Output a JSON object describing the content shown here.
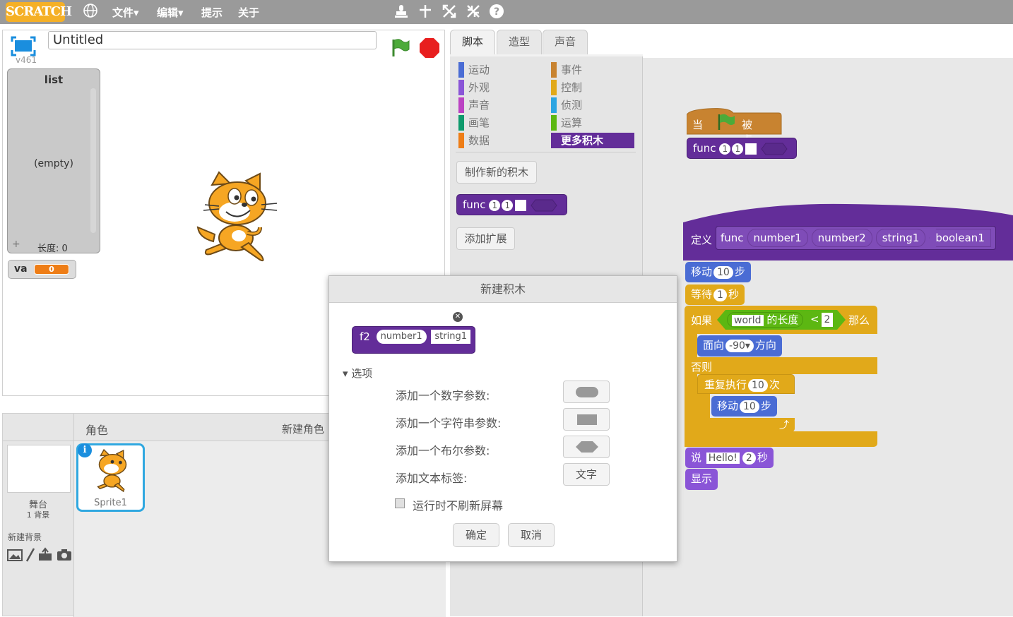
{
  "menubar": {
    "logo": "SCRATCH",
    "file": "文件▾",
    "edit": "编辑▾",
    "tips": "提示",
    "about": "关于"
  },
  "stage": {
    "title": "Untitled",
    "version": "v461",
    "list": {
      "title": "list",
      "empty": "(empty)",
      "plus": "+",
      "length": "长度: 0"
    },
    "variable": {
      "name": "va",
      "value": "0"
    }
  },
  "tabs": [
    "脚本",
    "造型",
    "声音"
  ],
  "palette": {
    "categories_left": [
      {
        "label": "运动",
        "color": "#4a6cd4"
      },
      {
        "label": "外观",
        "color": "#8a55d7"
      },
      {
        "label": "声音",
        "color": "#bb42c3"
      },
      {
        "label": "画笔",
        "color": "#0e9a6c"
      },
      {
        "label": "数据",
        "color": "#ee7d16"
      }
    ],
    "categories_right": [
      {
        "label": "事件",
        "color": "#c88330"
      },
      {
        "label": "控制",
        "color": "#e1a91a"
      },
      {
        "label": "侦测",
        "color": "#2ca5e2"
      },
      {
        "label": "运算",
        "color": "#5cb712"
      },
      {
        "label": "更多积木",
        "color": "#632d99"
      }
    ],
    "make_block": "制作新的积木",
    "add_extension": "添加扩展",
    "func_block": {
      "name": "func",
      "n1": "1",
      "n2": "1"
    }
  },
  "script": {
    "hat": {
      "when": "当",
      "clicked": "被点击"
    },
    "func_call": {
      "name": "func",
      "n1": "1",
      "n2": "1"
    },
    "define": {
      "label": "定义",
      "name": "func",
      "args": [
        "number1",
        "number2",
        "string1",
        "boolean1"
      ]
    },
    "move1": {
      "label": "移动",
      "steps": "10",
      "unit": "步"
    },
    "wait": {
      "label": "等待",
      "secs": "1",
      "unit": "秒"
    },
    "if": {
      "label": "如果",
      "str": "world",
      "len": "的长度",
      "op": "<",
      "num": "2",
      "then": "那么"
    },
    "point": {
      "label": "面向",
      "dir": "-90▾",
      "unit": "方向"
    },
    "else": "否则",
    "repeat": {
      "label": "重复执行",
      "times": "10",
      "unit": "次"
    },
    "move2": {
      "label": "移动",
      "steps": "10",
      "unit": "步"
    },
    "say": {
      "label": "说",
      "text": "Hello!",
      "secs": "2",
      "unit": "秒"
    },
    "show": "显示"
  },
  "sprites": {
    "header": "角色",
    "new_sprite": "新建角色",
    "stage_label": "舞台",
    "backdrop_count": "1 背景",
    "new_backdrop": "新建背景",
    "sprite_name": "Sprite1",
    "info": "i"
  },
  "dialog": {
    "title": "新建积木",
    "preview": {
      "name": "f2",
      "arg1": "number1",
      "arg2": "string1"
    },
    "options": "▾ 选项",
    "add_number": "添加一个数字参数:",
    "add_string": "添加一个字符串参数:",
    "add_boolean": "添加一个布尔参数:",
    "add_label": "添加文本标签:",
    "label_btn": "文字",
    "no_refresh": "运行时不刷新屏幕",
    "ok": "确定",
    "cancel": "取消"
  }
}
